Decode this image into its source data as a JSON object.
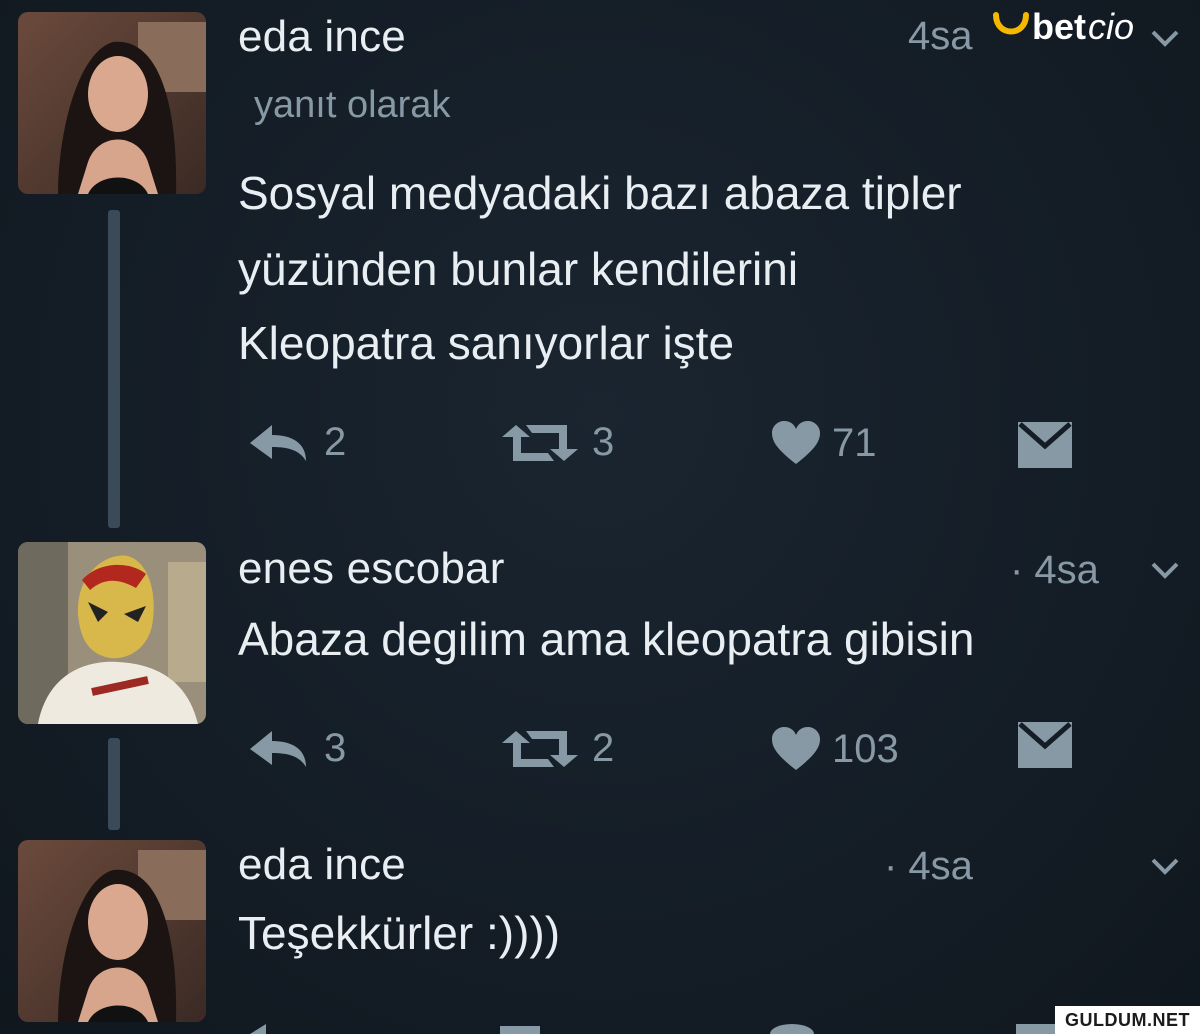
{
  "brand": {
    "logo_text_bold": "bet",
    "logo_text_light": "cio",
    "logo_icon": "horseshoe-icon"
  },
  "watermark": "GULDUM.NET",
  "tweets": [
    {
      "author": "eda ince",
      "time": "4sa",
      "reply_label": "yanıt olarak",
      "lines": [
        "Sosyal medyadaki bazı abaza tipler",
        "yüzünden bunlar kendilerini",
        "Kleopatra sanıyorlar işte"
      ],
      "replies": "2",
      "retweets": "3",
      "likes": "71"
    },
    {
      "author": "enes escobar",
      "time": "· 4sa",
      "lines": [
        "Abaza degilim ama kleopatra gibisin"
      ],
      "replies": "3",
      "retweets": "2",
      "likes": "103"
    },
    {
      "author": "eda ince",
      "time": "· 4sa",
      "lines": [
        "Teşekkürler :))))"
      ]
    }
  ],
  "colors": {
    "background": "#141d26",
    "text": "#e9eef2",
    "muted": "#8899a6",
    "thread_line": "#3b4a58",
    "brand_accent": "#f5b800"
  }
}
